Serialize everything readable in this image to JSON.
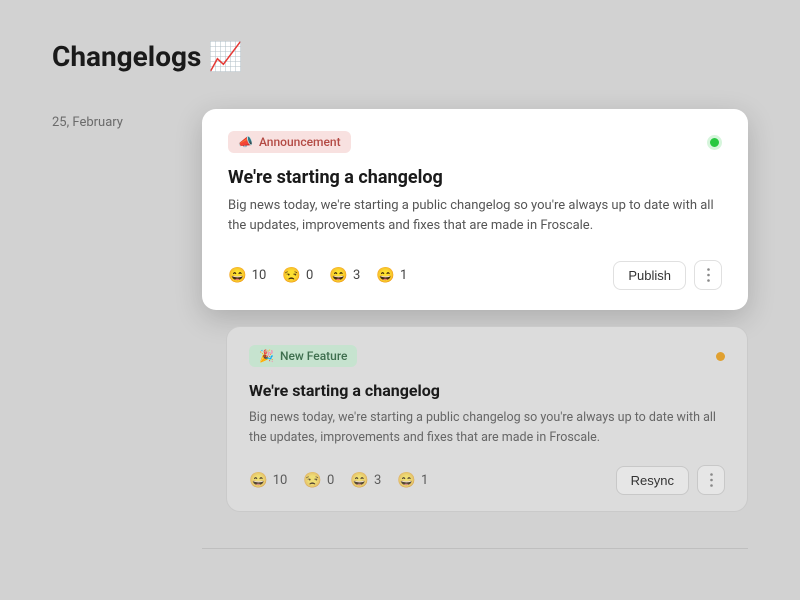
{
  "header": {
    "title": "Changelogs 📈"
  },
  "date": "25, February",
  "cards": [
    {
      "tag_emoji": "📣",
      "tag_label": "Announcement",
      "title": "We're starting a changelog",
      "body": "Big news today, we're starting a public changelog so you're always up to date with all the updates, improvements and fixes that are made in Froscale.",
      "reactions": [
        {
          "emoji": "😄",
          "count": "10"
        },
        {
          "emoji": "😒",
          "count": "0"
        },
        {
          "emoji": "😄",
          "count": "3"
        },
        {
          "emoji": "😄",
          "count": "1"
        }
      ],
      "action_label": "Publish"
    },
    {
      "tag_emoji": "🎉",
      "tag_label": "New Feature",
      "title": "We're starting a changelog",
      "body": "Big news today, we're starting a public changelog so you're always up to date with all the updates, improvements and fixes that are made in Froscale.",
      "reactions": [
        {
          "emoji": "😄",
          "count": "10"
        },
        {
          "emoji": "😒",
          "count": "0"
        },
        {
          "emoji": "😄",
          "count": "3"
        },
        {
          "emoji": "😄",
          "count": "1"
        }
      ],
      "action_label": "Resync"
    }
  ]
}
